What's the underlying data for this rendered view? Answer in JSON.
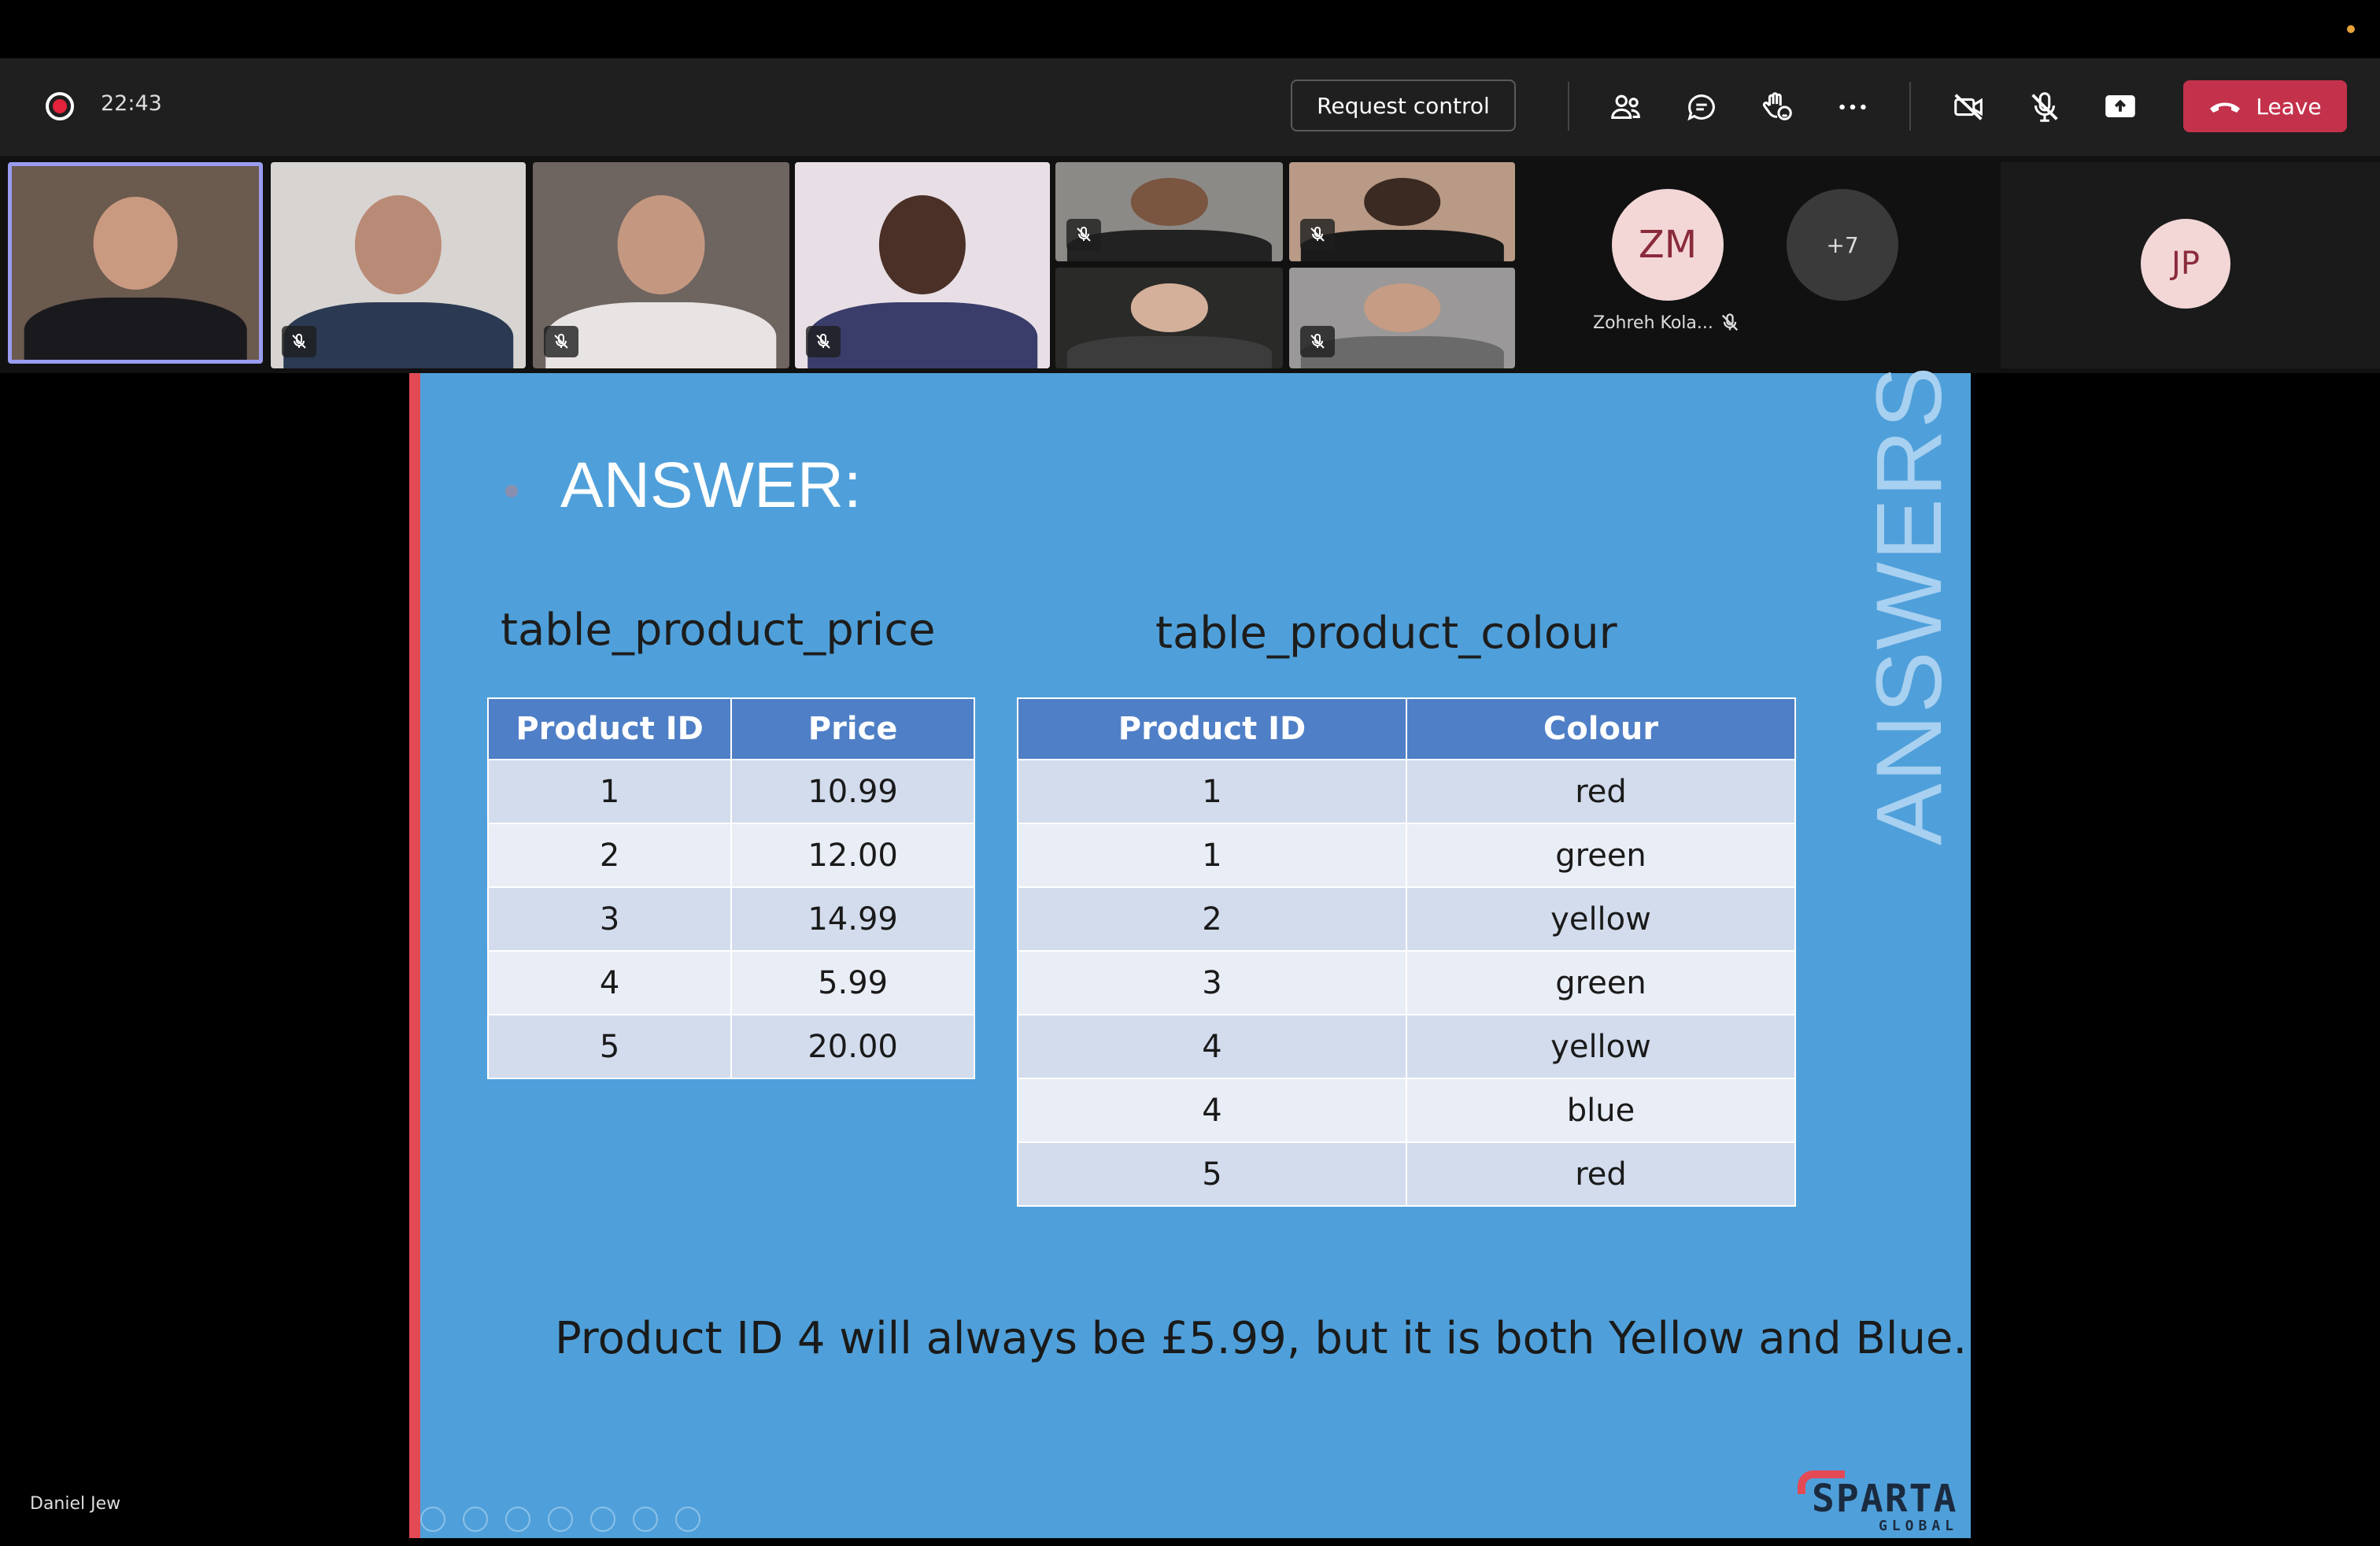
{
  "toolbar": {
    "timer": "22:43",
    "request_control_label": "Request control",
    "leave_label": "Leave"
  },
  "participants": {
    "zm_initials": "ZM",
    "zm_name": "Zohreh Kola...",
    "more_count": "+7",
    "jp_initials": "JP",
    "presenter_name": "Daniel Jew"
  },
  "slide": {
    "heading": "ANSWER:",
    "side_label": "ANSWERS",
    "table1_title": "table_product_price",
    "table2_title": "table_product_colour",
    "table1_headers": [
      "Product ID",
      "Price"
    ],
    "table1_rows": [
      [
        "1",
        "10.99"
      ],
      [
        "2",
        "12.00"
      ],
      [
        "3",
        "14.99"
      ],
      [
        "4",
        "5.99"
      ],
      [
        "5",
        "20.00"
      ]
    ],
    "table2_headers": [
      "Product ID",
      "Colour"
    ],
    "table2_rows": [
      [
        "1",
        "red"
      ],
      [
        "1",
        "green"
      ],
      [
        "2",
        "yellow"
      ],
      [
        "3",
        "green"
      ],
      [
        "4",
        "yellow"
      ],
      [
        "4",
        "blue"
      ],
      [
        "5",
        "red"
      ]
    ],
    "summary": "Product ID 4 will always be £5.99, but it is both Yellow and Blue.",
    "logo_main": "SPARTA",
    "logo_sub": "GLOBAL"
  },
  "colors": {
    "slide_bg": "#4fa0da",
    "table_header": "#4f7fc6",
    "leave_button": "#c4314b",
    "accent_bar": "#e34a56"
  }
}
